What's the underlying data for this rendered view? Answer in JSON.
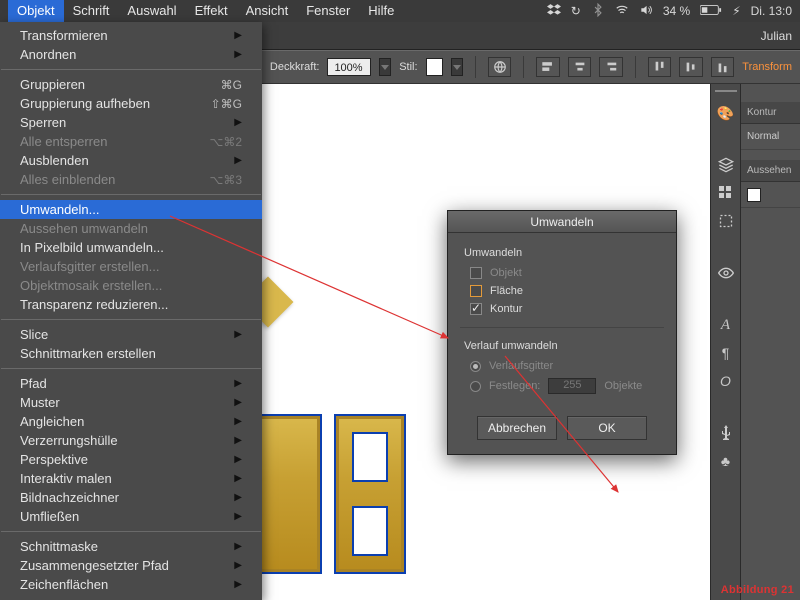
{
  "menubar": {
    "items": [
      "Objekt",
      "Schrift",
      "Auswahl",
      "Effekt",
      "Ansicht",
      "Fenster",
      "Hilfe"
    ],
    "selected_index": 0,
    "status": {
      "battery": "34 %",
      "charging_glyph": "⚡︎",
      "clock": "Di. 13:0"
    }
  },
  "titlebar": {
    "username": "Julian"
  },
  "toolbar": {
    "opacity_label": "Deckkraft:",
    "opacity_value": "100%",
    "style_label": "Stil:",
    "transform_link": "Transform"
  },
  "menu": {
    "groups": [
      [
        {
          "label": "Transformieren",
          "sub": true
        },
        {
          "label": "Anordnen",
          "sub": true
        }
      ],
      [
        {
          "label": "Gruppieren",
          "shortcut": "⌘G"
        },
        {
          "label": "Gruppierung aufheben",
          "shortcut": "⇧⌘G"
        },
        {
          "label": "Sperren",
          "sub": true
        },
        {
          "label": "Alle entsperren",
          "shortcut": "⌥⌘2",
          "disabled": true
        },
        {
          "label": "Ausblenden",
          "sub": true
        },
        {
          "label": "Alles einblenden",
          "shortcut": "⌥⌘3",
          "disabled": true
        }
      ],
      [
        {
          "label": "Umwandeln...",
          "hover": true
        },
        {
          "label": "Aussehen umwandeln",
          "disabled": true
        },
        {
          "label": "In Pixelbild umwandeln..."
        },
        {
          "label": "Verlaufsgitter erstellen...",
          "disabled": true
        },
        {
          "label": "Objektmosaik erstellen...",
          "disabled": true
        },
        {
          "label": "Transparenz reduzieren..."
        }
      ],
      [
        {
          "label": "Slice",
          "sub": true
        },
        {
          "label": "Schnittmarken erstellen"
        }
      ],
      [
        {
          "label": "Pfad",
          "sub": true
        },
        {
          "label": "Muster",
          "sub": true
        },
        {
          "label": "Angleichen",
          "sub": true
        },
        {
          "label": "Verzerrungshülle",
          "sub": true
        },
        {
          "label": "Perspektive",
          "sub": true
        },
        {
          "label": "Interaktiv malen",
          "sub": true
        },
        {
          "label": "Bildnachzeichner",
          "sub": true
        },
        {
          "label": "Umfließen",
          "sub": true
        }
      ],
      [
        {
          "label": "Schnittmaske",
          "sub": true
        },
        {
          "label": "Zusammengesetzter Pfad",
          "sub": true
        },
        {
          "label": "Zeichenflächen",
          "sub": true
        }
      ]
    ]
  },
  "dialog": {
    "title": "Umwandeln",
    "section1_title": "Umwandeln",
    "opt_object": "Objekt",
    "opt_fill": "Fläche",
    "opt_stroke": "Kontur",
    "opt_stroke_checked": true,
    "section2_title": "Verlauf umwandeln",
    "opt_mesh": "Verlaufsgitter",
    "opt_specify": "Festlegen:",
    "specify_value": "255",
    "specify_unit": "Objekte",
    "btn_cancel": "Abbrechen",
    "btn_ok": "OK"
  },
  "panels": {
    "tab_kontur": "Kontur",
    "mode": "Normal",
    "tab_aussehen": "Aussehen"
  },
  "caption": "Abbildung  21"
}
